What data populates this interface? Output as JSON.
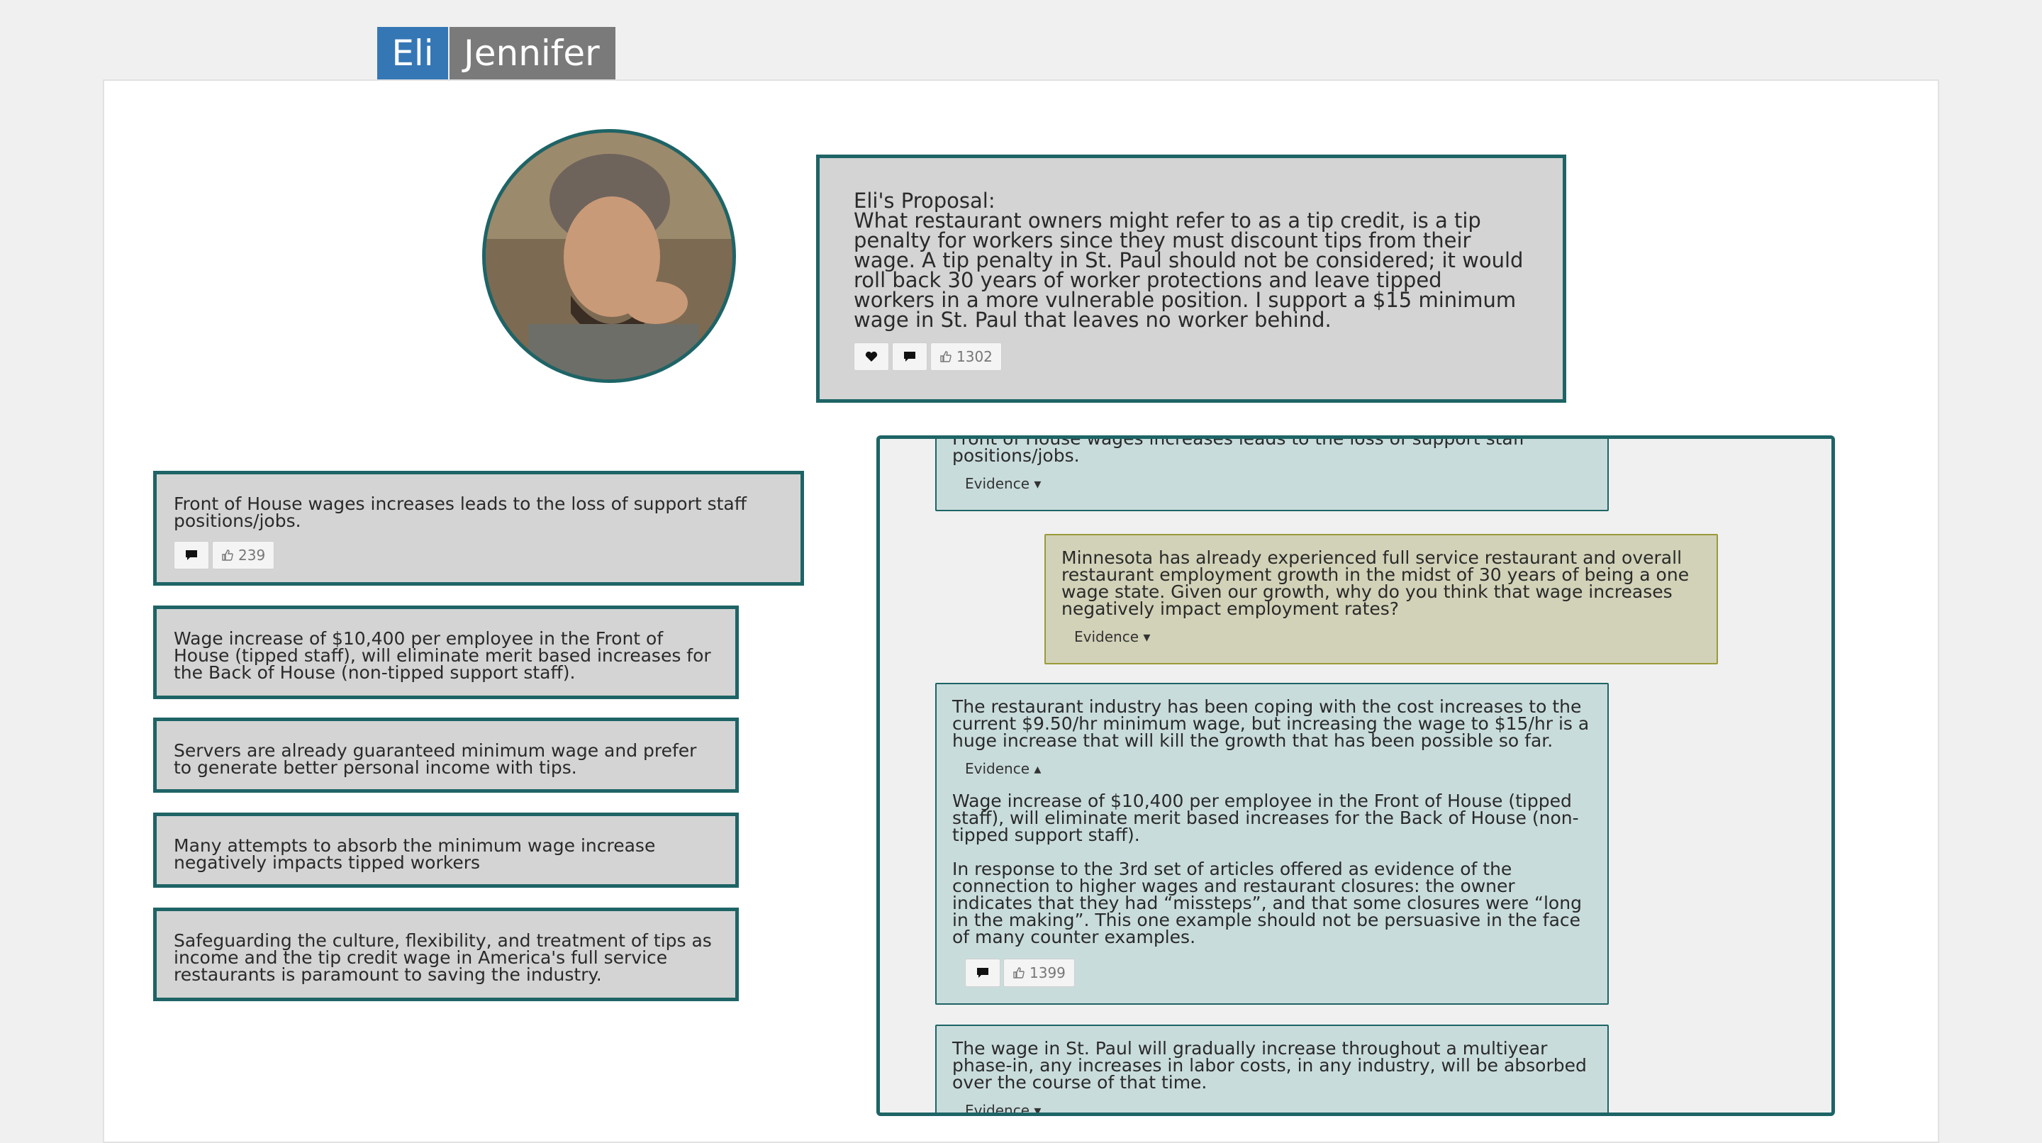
{
  "tabs": {
    "eli": "Eli",
    "jennifer": "Jennifer"
  },
  "proposal": {
    "title": "Eli's Proposal:",
    "text": "What restaurant owners might refer to as a tip credit, is a tip penalty for workers since they must discount tips from their wage. A tip penalty in St. Paul should not be considered; it would roll back 30 years of worker protections and leave tipped workers in a more vulnerable position. I support a $15 minimum wage in St. Paul that leaves no worker behind.",
    "likes": "1302"
  },
  "left_cards": [
    {
      "text": "Front of House wages increases leads to the loss of support staff positions/jobs.",
      "likes": "239"
    },
    {
      "text": "Wage increase of $10,400 per employee in the Front of House (tipped staff), will eliminate merit based increases for the Back of House (non-tipped support staff)."
    },
    {
      "text": "Servers are already guaranteed minimum wage and prefer to generate better personal income with tips."
    },
    {
      "text": "Many attempts to absorb the minimum wage increase negatively impacts tipped workers"
    },
    {
      "text": "Safeguarding the culture, flexibility, and treatment of tips as income and the tip credit wage in America's full service restaurants is paramount to saving the industry."
    }
  ],
  "thread": {
    "top_card": {
      "text": "Front of House wages increases leads to the loss of support staff positions/jobs.",
      "evidence": "Evidence"
    },
    "question": {
      "text": "Minnesota has already experienced full service restaurant and overall restaurant employment growth in the midst of 30 years of being a one wage state. Given our growth, why do you think that wage increases negatively impact employment rates?",
      "evidence": "Evidence"
    },
    "response": {
      "text": "The restaurant industry has been coping with the cost increases to the current $9.50/hr minimum wage, but increasing the wage to $15/hr is a huge increase that will kill the growth that has been possible so far.",
      "evidence": "Evidence",
      "evidence_item": "Wage increase of $10,400 per employee in the Front of House (tipped staff), will eliminate merit based increases for the Back of House (non-tipped support staff).",
      "rebuttal": "In response to the 3rd set of articles offered as evidence of the connection to higher wages and restaurant closures: the owner indicates that they had “missteps”, and that some closures were “long in the making”. This one example should not be persuasive in the face of many counter examples.",
      "likes": "1399"
    },
    "bottom_card": {
      "text": "The wage in St. Paul will gradually increase throughout a multiyear phase-in, any increases in labor costs, in any industry, will be absorbed over the course of that time.",
      "evidence": "Evidence"
    }
  },
  "icons": {
    "heart": "heart-icon",
    "comment": "comment-icon",
    "thumbs_up": "thumbs-up-icon",
    "caret_down": "caret-down-icon",
    "caret_up": "caret-up-icon"
  },
  "colors": {
    "teal_border": "#1e6466",
    "tab_active": "#3577b5",
    "tab_inactive": "#7a7a7a",
    "card_gray": "#d4d4d4",
    "reply_blue": "#c9dcdc",
    "reply_olive": "#d2d2b8"
  }
}
